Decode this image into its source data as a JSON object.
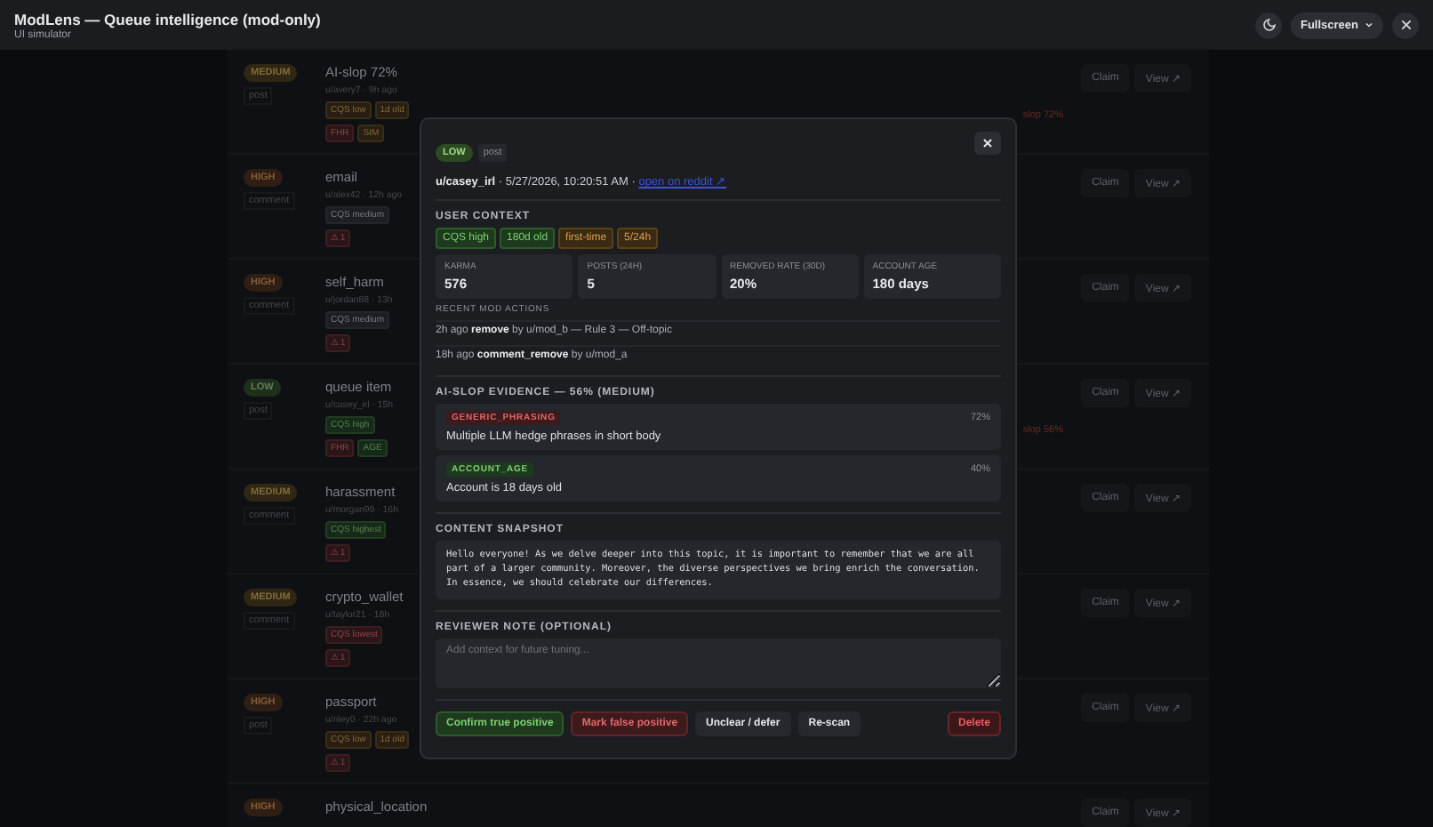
{
  "header": {
    "title": "ModLens — Queue intelligence (mod-only)",
    "subtitle": "UI simulator",
    "fullscreen": "Fullscreen"
  },
  "queue": [
    {
      "severity": {
        "label": "MEDIUM",
        "kind": "medium"
      },
      "type": "post",
      "title": "AI-slop 72%",
      "meta": "u/avery7 · 9h ago",
      "chips": [
        {
          "label": "CQS low",
          "kind": "warn"
        },
        {
          "label": "1d old",
          "kind": "warn"
        }
      ],
      "flags": [
        {
          "label": "FHR",
          "kind": "bad"
        },
        {
          "label": "SIM",
          "kind": "warn"
        }
      ],
      "note": "slop 72%",
      "actions": [
        "Claim",
        "View ↗"
      ]
    },
    {
      "severity": {
        "label": "HIGH",
        "kind": "high"
      },
      "type": "comment",
      "title": "email",
      "meta": "u/alex42 · 12h ago",
      "chips": [
        {
          "label": "CQS medium",
          "kind": "neutral"
        }
      ],
      "flags": [
        {
          "label": "⚠ 1",
          "kind": "bad"
        }
      ],
      "actions": [
        "Claim",
        "View ↗"
      ]
    },
    {
      "severity": {
        "label": "HIGH",
        "kind": "high"
      },
      "type": "comment",
      "title": "self_harm",
      "meta": "u/jordan88 · 13h",
      "chips": [
        {
          "label": "CQS medium",
          "kind": "neutral"
        }
      ],
      "flags": [
        {
          "label": "⚠ 1",
          "kind": "bad"
        }
      ],
      "actions": [
        "Claim",
        "View ↗"
      ]
    },
    {
      "severity": {
        "label": "LOW",
        "kind": "low"
      },
      "type": "post",
      "title": "queue item",
      "meta": "u/casey_irl · 15h",
      "chips": [
        {
          "label": "CQS high",
          "kind": "good"
        }
      ],
      "flags": [
        {
          "label": "FHR",
          "kind": "bad"
        },
        {
          "label": "AGE",
          "kind": "good"
        }
      ],
      "note": "slop 56%",
      "actions": [
        "Claim",
        "View ↗"
      ]
    },
    {
      "severity": {
        "label": "MEDIUM",
        "kind": "medium"
      },
      "type": "comment",
      "title": "harassment",
      "meta": "u/morgan99 · 16h",
      "chips": [
        {
          "label": "CQS highest",
          "kind": "good"
        }
      ],
      "flags": [
        {
          "label": "⚠ 1",
          "kind": "bad"
        }
      ],
      "actions": [
        "Claim",
        "View ↗"
      ]
    },
    {
      "severity": {
        "label": "MEDIUM",
        "kind": "medium"
      },
      "type": "comment",
      "title": "crypto_wallet",
      "meta": "u/taylor21 · 18h",
      "chips": [
        {
          "label": "CQS lowest",
          "kind": "bad"
        }
      ],
      "flags": [
        {
          "label": "⚠ 1",
          "kind": "bad"
        }
      ],
      "actions": [
        "Claim",
        "View ↗"
      ]
    },
    {
      "severity": {
        "label": "HIGH",
        "kind": "high"
      },
      "type": "post",
      "title": "passport",
      "meta": "u/riley0 · 22h ago",
      "chips": [
        {
          "label": "CQS low",
          "kind": "warn"
        },
        {
          "label": "1d old",
          "kind": "warn"
        }
      ],
      "flags": [
        {
          "label": "⚠ 1",
          "kind": "bad"
        }
      ],
      "actions": [
        "Claim",
        "View ↗"
      ]
    },
    {
      "severity": {
        "label": "HIGH",
        "kind": "high"
      },
      "title": "physical_location",
      "actions": [
        "Claim",
        "View ↗"
      ]
    }
  ],
  "modal": {
    "severity": {
      "label": "LOW",
      "kind": "low"
    },
    "type": "post",
    "author": "u/casey_irl",
    "timestamp": " · 5/27/2026, 10:20:51 AM · ",
    "link": "open on reddit ↗",
    "user_context": {
      "heading": "USER CONTEXT",
      "chips": [
        {
          "label": "CQS high",
          "kind": "good"
        },
        {
          "label": "180d old",
          "kind": "good"
        },
        {
          "label": "first-time",
          "kind": "warn"
        },
        {
          "label": "5/24h",
          "kind": "warn"
        }
      ],
      "stats": [
        {
          "label": "KARMA",
          "value": "576"
        },
        {
          "label": "POSTS (24H)",
          "value": "5"
        },
        {
          "label": "REMOVED RATE (30D)",
          "value": "20%"
        },
        {
          "label": "ACCOUNT AGE",
          "value": "180 days"
        }
      ],
      "actions_heading": "RECENT MOD ACTIONS",
      "actions": [
        "2h ago **remove** by u/mod_b — Rule 3 — Off-topic",
        "18h ago **comment_remove** by u/mod_a"
      ]
    },
    "evidence": {
      "heading": "AI-SLOP EVIDENCE — 56% (MEDIUM)",
      "items": [
        {
          "tag": "GENERIC_PHRASING",
          "kind": "bad",
          "score": "72%",
          "text": "Multiple LLM hedge phrases in short body"
        },
        {
          "tag": "ACCOUNT_AGE",
          "kind": "good",
          "score": "40%",
          "text": "Account is 18 days old"
        }
      ]
    },
    "snapshot": {
      "heading": "CONTENT SNAPSHOT",
      "text": "Hello everyone! As we delve deeper into this topic, it is important to remember that we are all part of a larger community. Moreover, the diverse perspectives we bring enrich the conversation. In essence, we should celebrate our differences."
    },
    "note": {
      "heading": "REVIEWER NOTE (OPTIONAL)",
      "placeholder": "Add context for future tuning..."
    },
    "buttons": [
      {
        "label": "Confirm true positive",
        "kind": "good"
      },
      {
        "label": "Mark false positive",
        "kind": "bad"
      },
      {
        "label": "Unclear / defer",
        "kind": "neutral"
      },
      {
        "label": "Re-scan",
        "kind": "neutral"
      },
      {
        "label": "Delete",
        "kind": "danger"
      }
    ]
  }
}
